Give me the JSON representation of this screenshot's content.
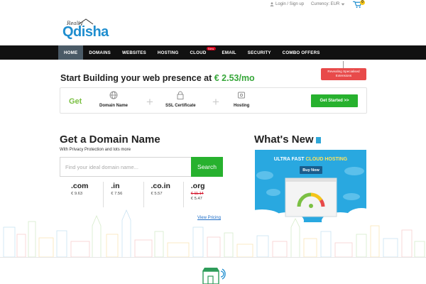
{
  "topbar": {
    "login_label": "Login / Sign up",
    "currency_label": "Currency: EUR",
    "cart_count": "0"
  },
  "logo": {
    "small_text": "Realty",
    "brand_text": "Qdisha"
  },
  "nav": {
    "items": [
      {
        "label": "HOME"
      },
      {
        "label": "DOMAINS"
      },
      {
        "label": "WEBSITES"
      },
      {
        "label": "HOSTING"
      },
      {
        "label": "CLOUD",
        "badge": "New"
      },
      {
        "label": "EMAIL"
      },
      {
        "label": "SECURITY"
      },
      {
        "label": "COMBO OFFERS"
      }
    ]
  },
  "hero": {
    "title_prefix": "Start Building your web presence at ",
    "price": "€ 2.53/mo",
    "ribbon_line1": "Revealing Specialised",
    "ribbon_line2": "Extensions",
    "get_label": "Get",
    "features": [
      "Domain Name",
      "SSL Certificate",
      "Hosting"
    ],
    "cta_label": "Get Started >>"
  },
  "domain": {
    "title": "Get a Domain Name",
    "subtitle": "With Privacy Protection and lots more",
    "search_placeholder": "Find your ideal domain name...",
    "search_button": "Search",
    "tlds": [
      {
        "ext": ".com",
        "price": "€ 9.63"
      },
      {
        "ext": ".in",
        "price": "€ 7.56"
      },
      {
        "ext": ".co.in",
        "price": "€ 5.57"
      },
      {
        "ext": ".org",
        "old_price": "€ 11.14",
        "price": "€ 5.47"
      }
    ],
    "view_pricing": "View Pricing"
  },
  "whats_new": {
    "title": "What's New",
    "promo_head_white": "ULTRA FAST ",
    "promo_head_yellow": "CLOUD HOSTING",
    "buy_label": "Buy Now"
  },
  "colors": {
    "accent_green": "#27b12e",
    "brand_blue": "#1f8ecf",
    "nav_bg": "#111111",
    "promo_blue": "#29a8e0"
  }
}
